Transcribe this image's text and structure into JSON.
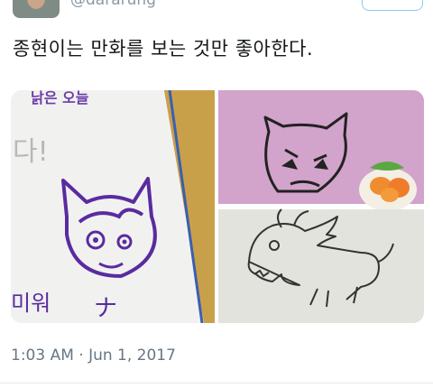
{
  "tweet": {
    "handle": "@dararung",
    "text": "종현이는 만화를 보는 것만 좋아한다.",
    "timestamp": "1:03 AM · Jun 1, 2017"
  },
  "photos": {
    "left_text_top": "낡은 오늘",
    "left_text_mid": "다!",
    "left_text_bottom": "미워",
    "left_text_mark": "ナ"
  },
  "icons": {
    "avatar": "profile-avatar",
    "follow": "follow-button"
  },
  "colors": {
    "link_blue": "#1da1f2",
    "muted": "#657786"
  }
}
